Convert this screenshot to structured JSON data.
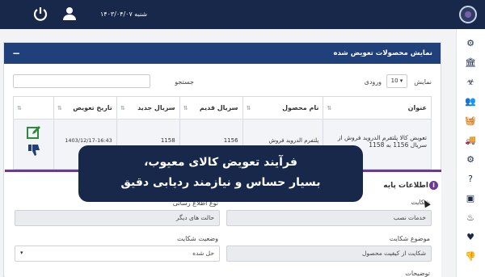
{
  "topbar": {
    "date": "شنبه ۱۴۰۳/۰۴/۰۷",
    "icons": {
      "power": "power-icon",
      "user": "user-icon",
      "logo": "app-logo"
    }
  },
  "sidebar": {
    "items": [
      "cogs-icon",
      "bank-icon",
      "biohazard-icon",
      "users-icon",
      "basket-icon",
      "truck-icon",
      "gear-icon",
      "question-icon",
      "cube-icon",
      "fire-icon",
      "heartbeat-icon",
      "thumbs-down-icon"
    ]
  },
  "panel": {
    "title": "نمایش محصولات تعویض شده",
    "collapse_label": "−"
  },
  "table_controls": {
    "show_label": "نمایش",
    "entries_value": "10",
    "entries_label": "ورودی",
    "search_label": "جستجو"
  },
  "table": {
    "columns": [
      "عنوان",
      "نام محصول",
      "سریال قدیم",
      "سریال جدید",
      "تاریخ تعویض"
    ],
    "rows": [
      [
        "تعویض کالا پلتفرم الدروید فروش از سریال 1156 به 1158",
        "پلتفرم الدروید فروش",
        "1156",
        "1158",
        "1403/12/17-16:43"
      ]
    ]
  },
  "sub_panel": {
    "title": "اطلاعات پایه",
    "fields": {
      "complaint_label": "شکایت",
      "complaint_value": "خدمات نصب",
      "notify_type_label": "نوع اطلاع رسانی",
      "notify_type_value": "حالت های دیگر",
      "complaint_subject_label": "موضوع شکایت",
      "complaint_subject_value": "شکایت از کیفیت محصول",
      "complaint_status_label": "وضعیت شکایت",
      "complaint_status_value": "حل شده",
      "description_label": "توضیحات"
    }
  },
  "banner": {
    "line1": "فرآیند تعویض کالای معیوب،",
    "line2": "بسیار حساس و نیازمند ردیابی دقیق"
  },
  "colors": {
    "topbar": "#18284a",
    "panel_header": "#20407c",
    "accent": "#6c3a96",
    "edit_green": "#2d8a3a"
  }
}
